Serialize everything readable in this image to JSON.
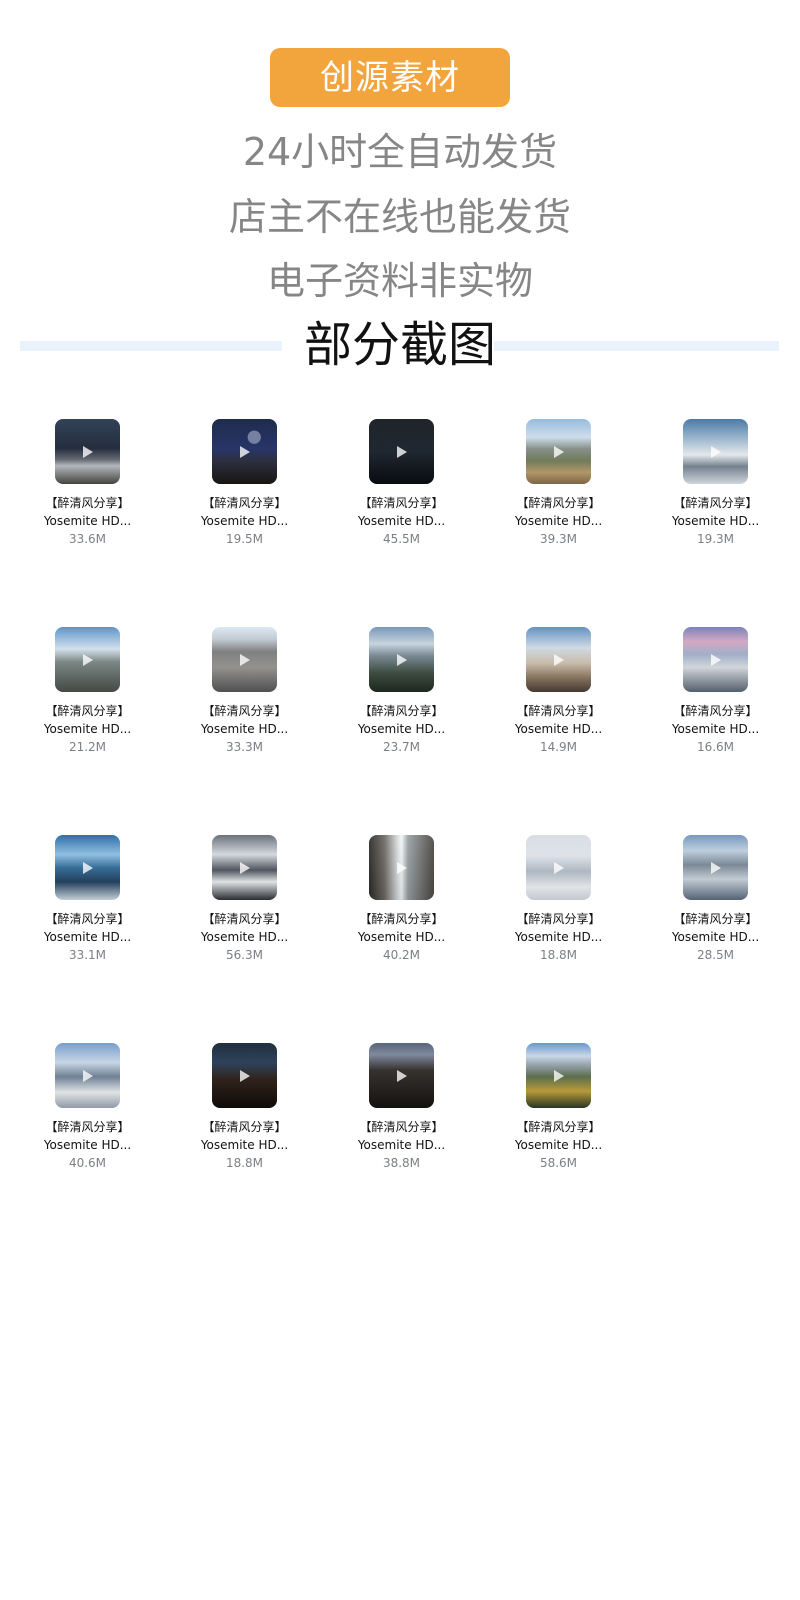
{
  "brand": {
    "name": "创源素材",
    "badge_color": "#f2a43d"
  },
  "taglines": [
    "24小时全自动发货",
    "店主不在线也能发货",
    "电子资料非实物"
  ],
  "section": {
    "title": "部分截图",
    "rule_color": "#eaf3fb"
  },
  "items": [
    {
      "name": "【醉清风分享】Yosemite HD...",
      "size": "33.6M",
      "thumb_style": "night-snow"
    },
    {
      "name": "【醉清风分享】Yosemite HD...",
      "size": "19.5M",
      "thumb_style": "milky-way"
    },
    {
      "name": "【醉清风分享】Yosemite HD...",
      "size": "45.5M",
      "thumb_style": "night-ridge"
    },
    {
      "name": "【醉清风分享】Yosemite HD...",
      "size": "39.3M",
      "thumb_style": "alpine-meadow"
    },
    {
      "name": "【醉清风分享】Yosemite HD...",
      "size": "19.3M",
      "thumb_style": "snow-ridge"
    },
    {
      "name": "【醉清风分享】Yosemite HD...",
      "size": "21.2M",
      "thumb_style": "rock-sky"
    },
    {
      "name": "【醉清风分享】Yosemite HD...",
      "size": "33.3M",
      "thumb_style": "granite"
    },
    {
      "name": "【醉清风分享】Yosemite HD...",
      "size": "23.7M",
      "thumb_style": "valley-cloud"
    },
    {
      "name": "【醉清风分享】Yosemite HD...",
      "size": "14.9M",
      "thumb_style": "sunlit-rock"
    },
    {
      "name": "【醉清风分享】Yosemite HD...",
      "size": "16.6M",
      "thumb_style": "pink-sky"
    },
    {
      "name": "【醉清风分享】Yosemite HD...",
      "size": "33.1M",
      "thumb_style": "blue-lake"
    },
    {
      "name": "【醉清风分享】Yosemite HD...",
      "size": "56.3M",
      "thumb_style": "snow-slope"
    },
    {
      "name": "【醉清风分享】Yosemite HD...",
      "size": "40.2M",
      "thumb_style": "waterfall"
    },
    {
      "name": "【醉清风分享】Yosemite HD...",
      "size": "18.8M",
      "thumb_style": "snow-fog"
    },
    {
      "name": "【醉清风分享】Yosemite HD...",
      "size": "28.5M",
      "thumb_style": "half-dome-mist"
    },
    {
      "name": "【醉清风分享】Yosemite HD...",
      "size": "40.6M",
      "thumb_style": "cloudy-dome"
    },
    {
      "name": "【醉清风分享】Yosemite HD...",
      "size": "18.8M",
      "thumb_style": "forest-night"
    },
    {
      "name": "【醉清风分享】Yosemite HD...",
      "size": "38.8M",
      "thumb_style": "dark-cliff"
    },
    {
      "name": "【醉清风分享】Yosemite HD...",
      "size": "58.6M",
      "thumb_style": "autumn-valley"
    }
  ]
}
